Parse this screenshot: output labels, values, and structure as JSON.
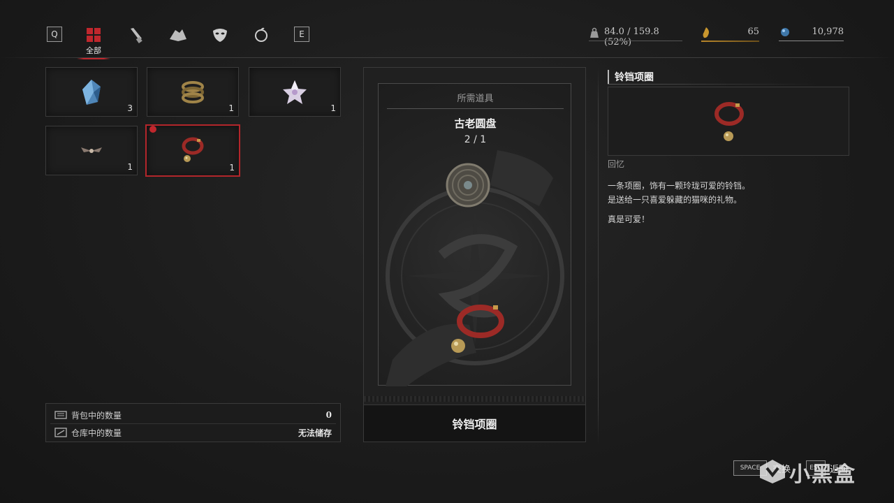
{
  "top_bar": {
    "left_key": "Q",
    "right_key": "E",
    "tabs": [
      {
        "name": "all",
        "icon": "grid-icon"
      },
      {
        "name": "tools",
        "icon": "scroll-icon"
      },
      {
        "name": "fragments",
        "icon": "rock-icon"
      },
      {
        "name": "masks",
        "icon": "mask-icon"
      },
      {
        "name": "consumables",
        "icon": "apple-icon"
      }
    ],
    "active_tab_label": "全部",
    "accent_color": "#c0272d"
  },
  "stats": {
    "weight": "84.0 / 159.8 (52%)",
    "ergo_count": "65",
    "currency": "10,978"
  },
  "inventory": {
    "slots": [
      {
        "name": "blue-crystal",
        "count": "3",
        "selected": false
      },
      {
        "name": "brass-coil",
        "count": "1",
        "selected": false
      },
      {
        "name": "star-crystal",
        "count": "1",
        "selected": false
      },
      {
        "name": "winged-trinket",
        "count": "1",
        "selected": false
      },
      {
        "name": "bell-collar",
        "count": "1",
        "selected": true
      }
    ]
  },
  "storage_info": {
    "backpack_label": "背包中的数量",
    "backpack_value": "0",
    "storage_label": "仓库中的数量",
    "storage_value": "无法储存"
  },
  "trade_card": {
    "header": "所需道具",
    "required_item": "古老圆盘",
    "count": "2 / 1",
    "reward_name": "铃铛项圈"
  },
  "detail": {
    "title": "铃铛项圈",
    "category": "回忆",
    "desc_line1": "一条项圈，饰有一颗玲珑可爱的铃铛。",
    "desc_line2": "是送给一只喜爱躲藏的猫咪的礼物。",
    "desc_line3": "真是可爱！"
  },
  "hints": {
    "space_key": "SPACE",
    "space_label": "交换",
    "esc_key": "ESC",
    "esc_label": "返回"
  },
  "watermark": "小黑盒"
}
